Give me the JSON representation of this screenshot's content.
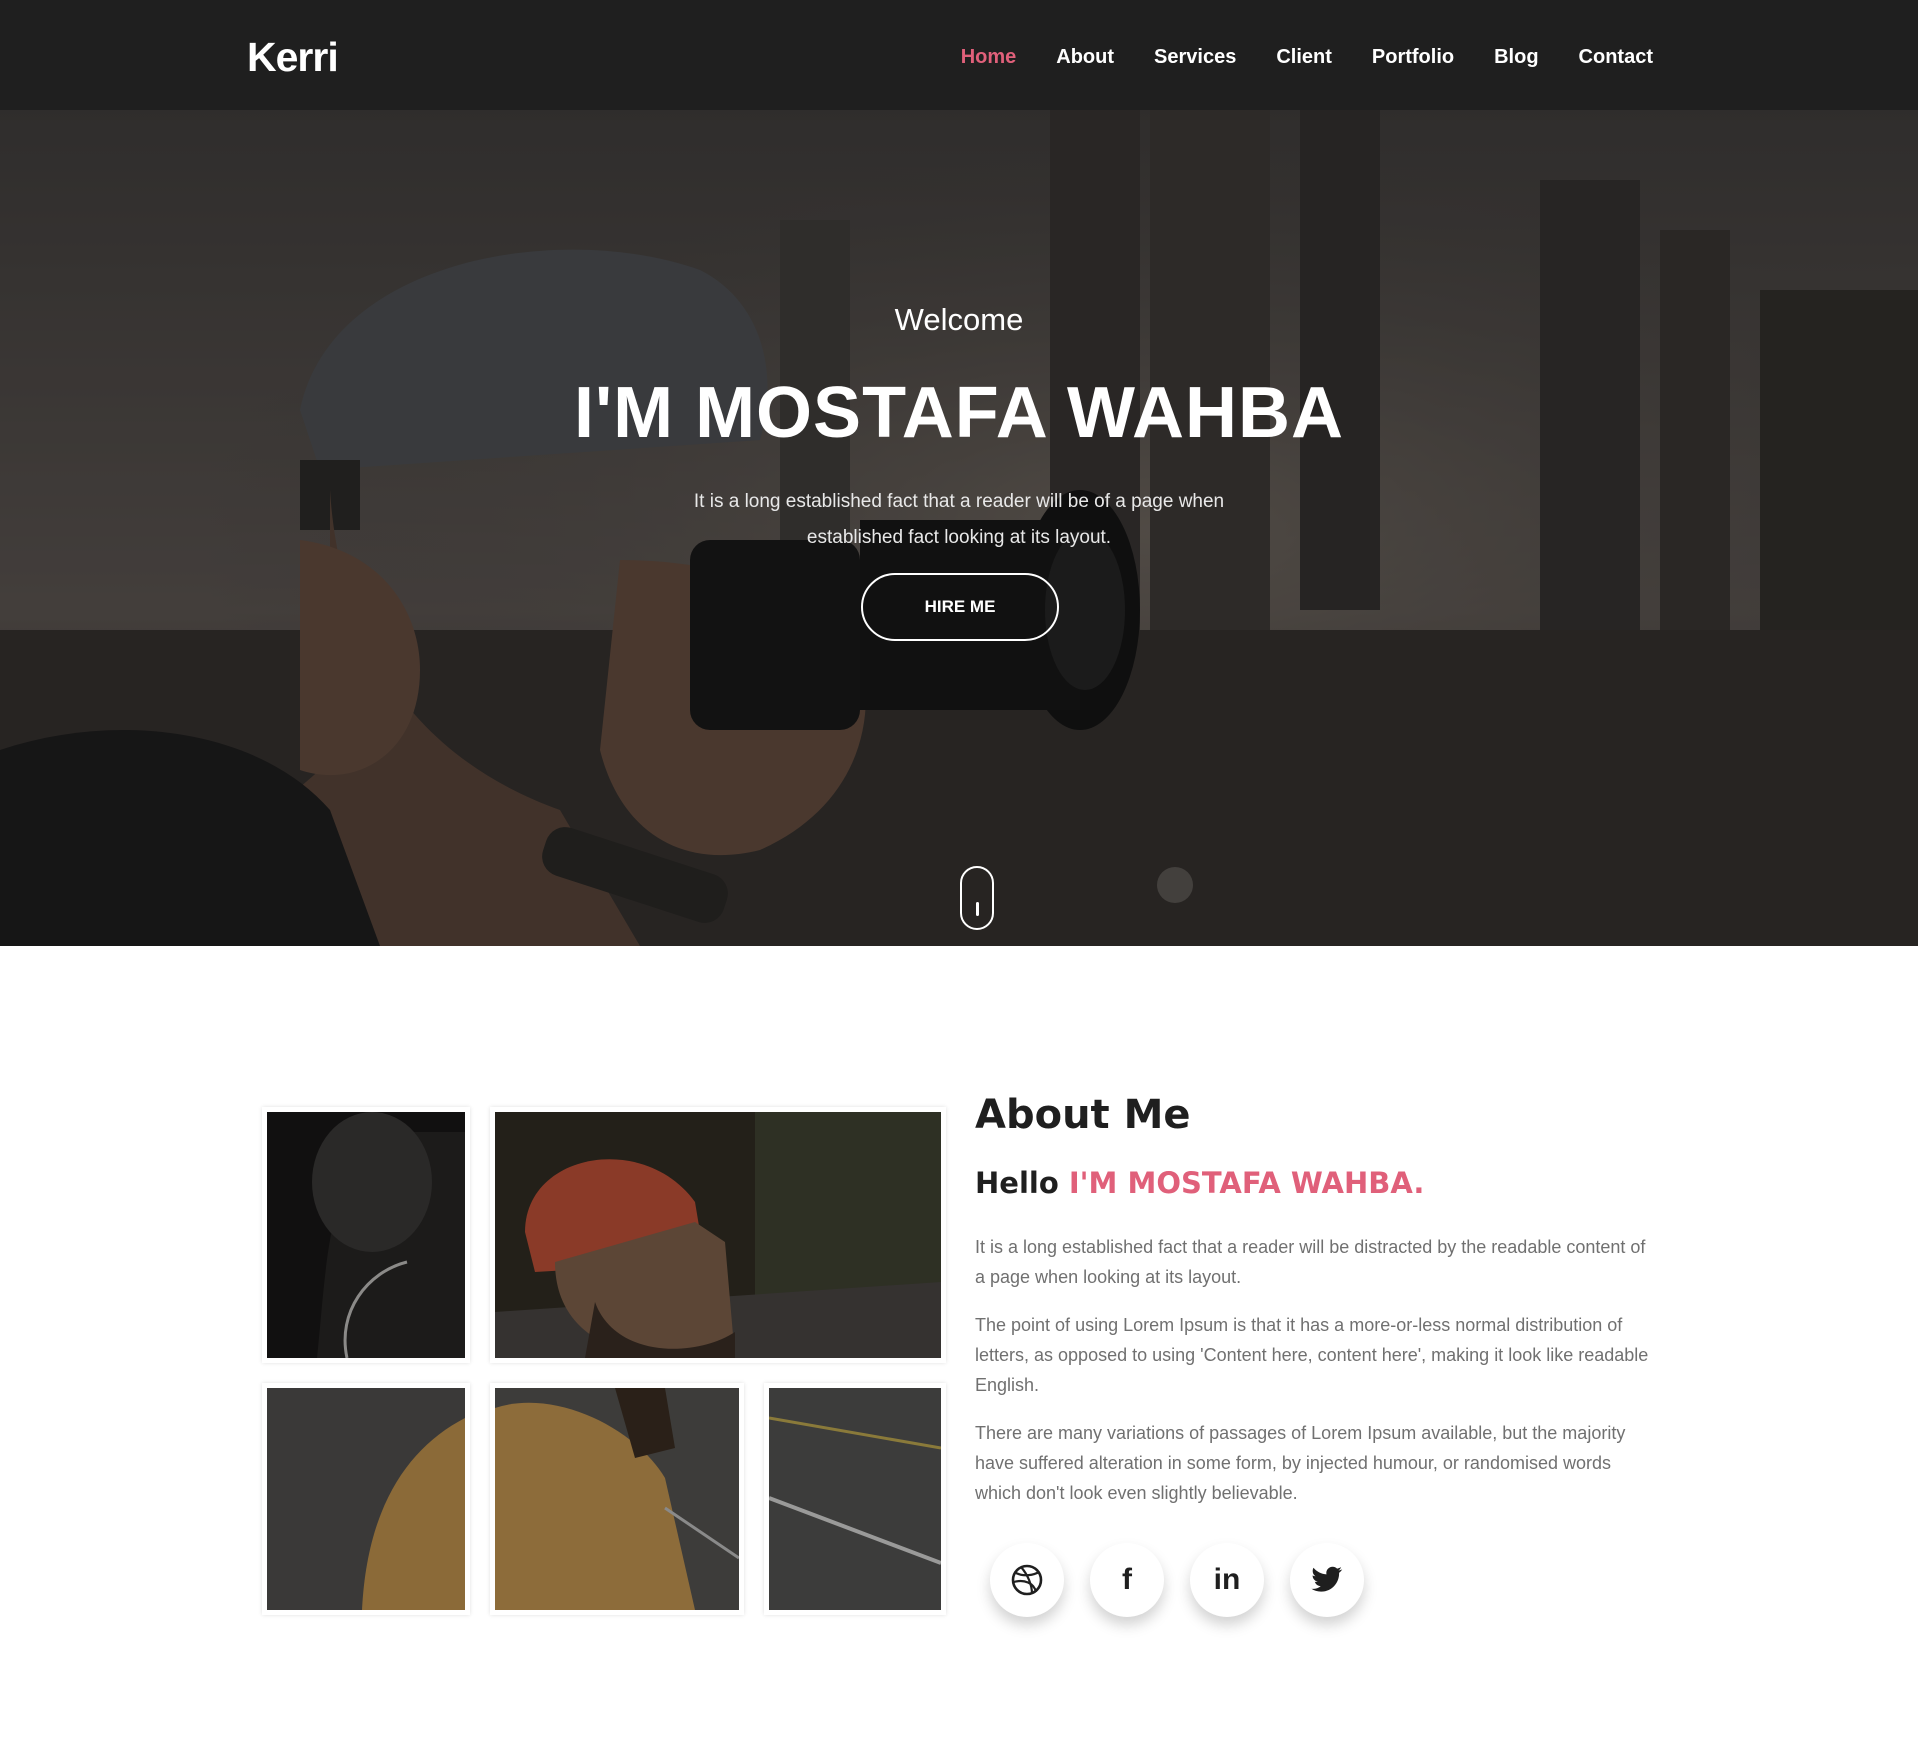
{
  "navbar": {
    "brand": "Kerri",
    "items": [
      {
        "label": "Home",
        "active": true
      },
      {
        "label": "About"
      },
      {
        "label": "Services"
      },
      {
        "label": "Client"
      },
      {
        "label": "Portfolio"
      },
      {
        "label": "Blog"
      },
      {
        "label": "Contact"
      }
    ]
  },
  "hero": {
    "welcome": "Welcome",
    "title": "I'M MOSTAFA WAHBA",
    "text": "It is a long established fact that a reader will be of a page when established fact looking at its layout.",
    "button": "HIRE ME",
    "scroll_icon": "mouse-scroll-icon"
  },
  "about": {
    "heading_strong": "About",
    "heading_rest": " Me",
    "hello": "Hello ",
    "name": "I'M MOSTAFA WAHBA.",
    "paragraphs": [
      "It is a long established fact that a reader will be distracted by the readable content of a page when looking at its layout.",
      "The point of using Lorem Ipsum is that it has a more-or-less normal distribution of letters, as opposed to using 'Content here, content here', making it look like readable English.",
      "There are many variations of passages of Lorem Ipsum available, but the majority have suffered alteration in some form, by injected humour, or randomised words which don't look even slightly believable."
    ],
    "socials": [
      {
        "icon": "dribbble-icon",
        "glyph": "⊛"
      },
      {
        "icon": "facebook-icon",
        "glyph": "f"
      },
      {
        "icon": "linkedin-icon",
        "glyph": "in"
      },
      {
        "icon": "twitter-icon",
        "glyph": "🐦"
      }
    ]
  },
  "colors": {
    "accent": "#e0607a",
    "navbar": "#1f1f1f",
    "text_muted": "#707070"
  }
}
